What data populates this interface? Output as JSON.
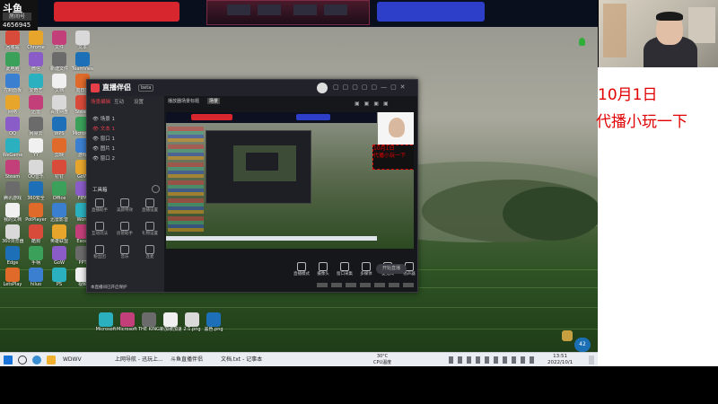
{
  "stream_overlay": {
    "platform_logo": "斗鱼",
    "platform_sub": "房间号",
    "room_id": "4656945",
    "notice_line1": "10月1日",
    "notice_line2": "代播小玩一下"
  },
  "app_window": {
    "title": "直播伴侣",
    "version_badge": "beta",
    "tabs": [
      "场景编辑",
      "互动",
      "设置"
    ],
    "scene_top_text": "播放器场景标题",
    "scene_badge": "场景",
    "scenes": [
      "场景 1",
      "文本 1",
      "窗口 1",
      "图片 1",
      "窗口 2"
    ],
    "tools_heading": "工具箱",
    "tools": [
      "直播助手",
      "美颜特效",
      "直播设置",
      "互动玩法",
      "房管助手",
      "礼物设置",
      "粉丝团",
      "音乐",
      "连麦"
    ],
    "live_status": "本直播间已开启保护",
    "bottom_actions": [
      "直播模式",
      "摄像头",
      "窗口采集",
      "多媒体",
      "麦克风",
      "扬声器"
    ],
    "start_button": "开始直播"
  },
  "nested_preview": {
    "notice_line1": "10月1日",
    "notice_line2": "代播小玩一下"
  },
  "desktop": {
    "icons_col1": [
      "回收站",
      "此电脑",
      "控制面板",
      "网络",
      "QQ",
      "WeGame",
      "Steam",
      "腾讯游戏",
      "我的文档",
      "360浏览器",
      "Edge",
      "LetsPlay"
    ],
    "icons_col2": [
      "Chrome",
      "微信",
      "爱奇艺",
      "迅雷",
      "网易云",
      "YY",
      "QQ音乐",
      "360安全",
      "PotPlayer",
      "酷狗",
      "手柄",
      "hiluo"
    ],
    "icons_col3": [
      "文件",
      "新建文件",
      "文档",
      "百度网盘",
      "WPS",
      "剪映",
      "钉钉",
      "Office",
      "迅雷影音",
      "英雄联盟",
      "GoW",
      "PS"
    ],
    "icons_col4": [
      "文本",
      "TeamViewer",
      "向日葵",
      "Steam",
      "Microsoft",
      "游戏",
      "GoW",
      "FIFA",
      "Word",
      "Excel",
      "PPT",
      "视频"
    ],
    "bottom_icons": [
      "Microsoft",
      "Microsoft Edge",
      "THE KING OF FIGH...",
      "新加坡加速...",
      "2:1.png",
      "黑色.png"
    ]
  },
  "taskbar": {
    "items": [
      "WDWV",
      "上网导航 - 迅玩上...",
      "斗鱼直播伴侣",
      "文档.txt - 记事本"
    ],
    "weather_temp": "30°C",
    "weather_desc": "CPU温度",
    "time": "13:51",
    "date": "2022/10/1",
    "volume_badge": "42"
  },
  "colors": {
    "banner_red": "#d8262e",
    "banner_blue": "#2d3fc9",
    "notice_red": "#e00000",
    "app_bg": "#1e1f24",
    "accent_red": "#e5404a"
  }
}
